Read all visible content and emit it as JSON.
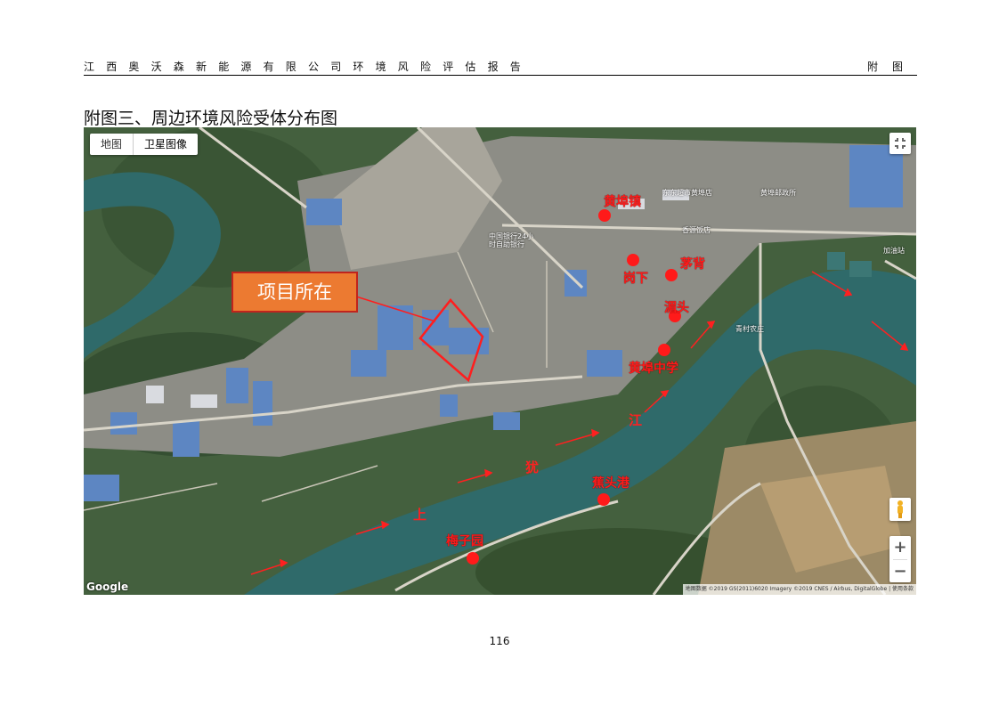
{
  "header": {
    "title": "江西奥沃森新能源有限公司环境风险评估报告",
    "right": "附图"
  },
  "figure_title": "附图三、周边环境风险受体分布图",
  "map": {
    "tab_map": "地图",
    "tab_satellite": "卫星图像",
    "project_label": "项目所在",
    "places": [
      "黄埠镇",
      "岗下",
      "茅背",
      "湄头",
      "黄埠中学",
      "蕉头港",
      "梅子园"
    ],
    "river_chars": [
      "上",
      "犹",
      "江"
    ],
    "pois": [
      "中国银行24小时自助银行",
      "东东超市黄埠店",
      "黄埠邮政所",
      "香源饭店",
      "加油站",
      "青村农庄"
    ],
    "google_logo": "Google",
    "attribution": "地图数据 ©2019 GS(2011)6020 Imagery ©2019 CNES / Airbus, DigitalGlobe | 使用条款",
    "colors": {
      "marker": "#ff1a1a",
      "project_fill": "#ec7a31",
      "project_border": "#c0241d",
      "river": "#2f6a6a"
    },
    "icons": [
      "fullscreen-icon",
      "pegman-icon",
      "zoom-in-icon",
      "zoom-out-icon"
    ]
  },
  "page_number": "116"
}
